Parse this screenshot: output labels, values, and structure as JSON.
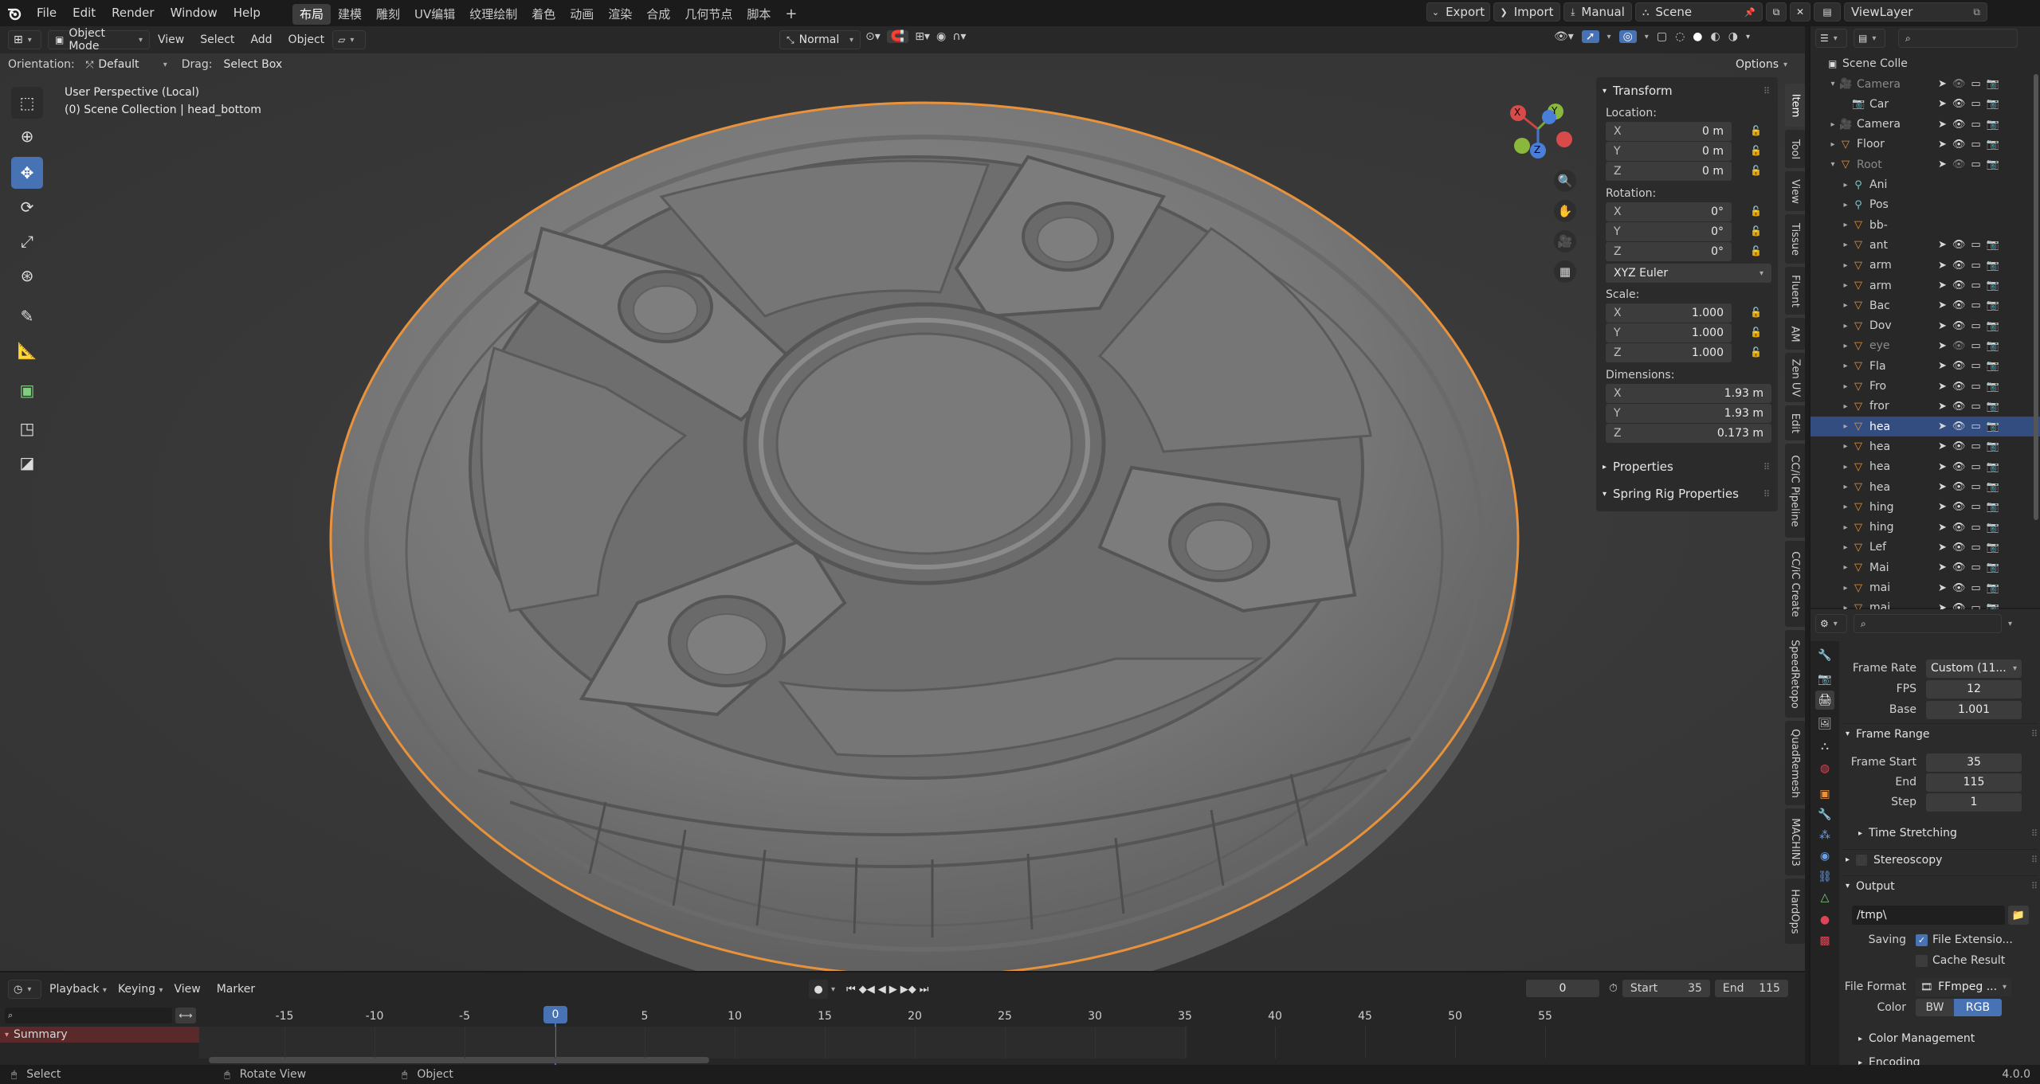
{
  "topbar": {
    "menus": [
      "File",
      "Edit",
      "Render",
      "Window",
      "Help"
    ],
    "workspaces": [
      "布局",
      "建模",
      "雕刻",
      "UV编辑",
      "纹理绘制",
      "着色",
      "动画",
      "渲染",
      "合成",
      "几何节点",
      "脚本"
    ],
    "active_workspace": "布局",
    "add_tab": "+",
    "export_label": "Export",
    "import_label": "Import",
    "manual_label": "Manual",
    "scene_name": "Scene",
    "view_layer": "ViewLayer"
  },
  "viewport_header": {
    "mode": "Object Mode",
    "menus": [
      "View",
      "Select",
      "Add",
      "Object"
    ],
    "transform_orientation": "Normal",
    "options_label": "Options"
  },
  "viewport_sub": {
    "orientation_label": "Orientation:",
    "orientation_value": "Default",
    "drag_label": "Drag:",
    "drag_value": "Select Box"
  },
  "viewport": {
    "perspective": "User Perspective (Local)",
    "collection_info": "(0) Scene Collection | head_bottom",
    "gizmo_axes": [
      "X",
      "Y",
      "Z"
    ]
  },
  "npanel": {
    "transform_title": "Transform",
    "location_label": "Location:",
    "location": [
      {
        "axis": "X",
        "value": "0 m"
      },
      {
        "axis": "Y",
        "value": "0 m"
      },
      {
        "axis": "Z",
        "value": "0 m"
      }
    ],
    "rotation_label": "Rotation:",
    "rotation": [
      {
        "axis": "X",
        "value": "0°"
      },
      {
        "axis": "Y",
        "value": "0°"
      },
      {
        "axis": "Z",
        "value": "0°"
      }
    ],
    "rotation_mode": "XYZ Euler",
    "scale_label": "Scale:",
    "scale": [
      {
        "axis": "X",
        "value": "1.000"
      },
      {
        "axis": "Y",
        "value": "1.000"
      },
      {
        "axis": "Z",
        "value": "1.000"
      }
    ],
    "dimensions_label": "Dimensions:",
    "dimensions": [
      {
        "axis": "X",
        "value": "1.93 m"
      },
      {
        "axis": "Y",
        "value": "1.93 m"
      },
      {
        "axis": "Z",
        "value": "0.173 m"
      }
    ],
    "properties_title": "Properties",
    "spring_title": "Spring Rig Properties"
  },
  "vertical_tabs": [
    "Item",
    "Tool",
    "View",
    "Tissue",
    "Fluent",
    "AM",
    "Zen UV",
    "Edit",
    "CC/iC Pipeline",
    "CC/iC Create",
    "SpeedRetopo",
    "QuadRemesh",
    "MACHIN3",
    "HardOps"
  ],
  "outliner": {
    "root": "Scene Colle",
    "rows": [
      {
        "name": "Camera",
        "dim": true
      },
      {
        "name": "Car",
        "dim": false
      },
      {
        "name": "Camera",
        "dim": false
      },
      {
        "name": "Floor",
        "dim": false
      },
      {
        "name": "Root",
        "dim": true
      },
      {
        "name": "Ani",
        "dim": false
      },
      {
        "name": "Pos",
        "dim": false
      },
      {
        "name": "bb-",
        "dim": false
      },
      {
        "name": "ant",
        "dim": false
      },
      {
        "name": "arm",
        "dim": false
      },
      {
        "name": "arm",
        "dim": false
      },
      {
        "name": "Bac",
        "dim": false
      },
      {
        "name": "Dov",
        "dim": false
      },
      {
        "name": "eye",
        "dim": true
      },
      {
        "name": "Fla",
        "dim": false
      },
      {
        "name": "Fro",
        "dim": false
      },
      {
        "name": "fror",
        "dim": false
      },
      {
        "name": "hea",
        "dim": false,
        "selected": true
      },
      {
        "name": "hea",
        "dim": false
      },
      {
        "name": "hea",
        "dim": false
      },
      {
        "name": "hea",
        "dim": false
      },
      {
        "name": "hing",
        "dim": false
      },
      {
        "name": "hing",
        "dim": false
      },
      {
        "name": "Lef",
        "dim": false
      },
      {
        "name": "Mai",
        "dim": false
      },
      {
        "name": "mai",
        "dim": false
      },
      {
        "name": "mai",
        "dim": false
      }
    ]
  },
  "properties": {
    "frame_rate_label": "Frame Rate",
    "frame_rate_value": "Custom (11...",
    "fps_label": "FPS",
    "fps_value": "12",
    "base_label": "Base",
    "base_value": "1.001",
    "frame_range_title": "Frame Range",
    "frame_start_label": "Frame Start",
    "frame_start_value": "35",
    "end_label": "End",
    "end_value": "115",
    "step_label": "Step",
    "step_value": "1",
    "time_stretching": "Time Stretching",
    "stereoscopy": "Stereoscopy",
    "output_title": "Output",
    "output_path": "/tmp\\",
    "saving_label": "Saving",
    "file_extensions": "File Extensio...",
    "cache_result": "Cache Result",
    "file_format_label": "File Format",
    "file_format_value": "FFmpeg ...",
    "color_label": "Color",
    "color_bw": "BW",
    "color_rgb": "RGB",
    "color_management": "Color Management",
    "encoding": "Encoding"
  },
  "timeline": {
    "menus": [
      "Playback",
      "Keying",
      "View",
      "Marker"
    ],
    "current_frame": "0",
    "start_label": "Start",
    "start_value": "35",
    "end_label": "End",
    "end_value": "115",
    "ruler": [
      "-15",
      "-10",
      "-5",
      "0",
      "5",
      "10",
      "15",
      "20",
      "25",
      "30",
      "35",
      "40",
      "45",
      "50",
      "55"
    ],
    "summary_label": "Summary"
  },
  "statusbar": {
    "select": "Select",
    "rotate": "Rotate View",
    "object": "Object",
    "version": "4.0.0"
  },
  "colors": {
    "accent": "#4772b3",
    "selection_outline": "#e8923b",
    "object_icon": "#e8923b"
  }
}
